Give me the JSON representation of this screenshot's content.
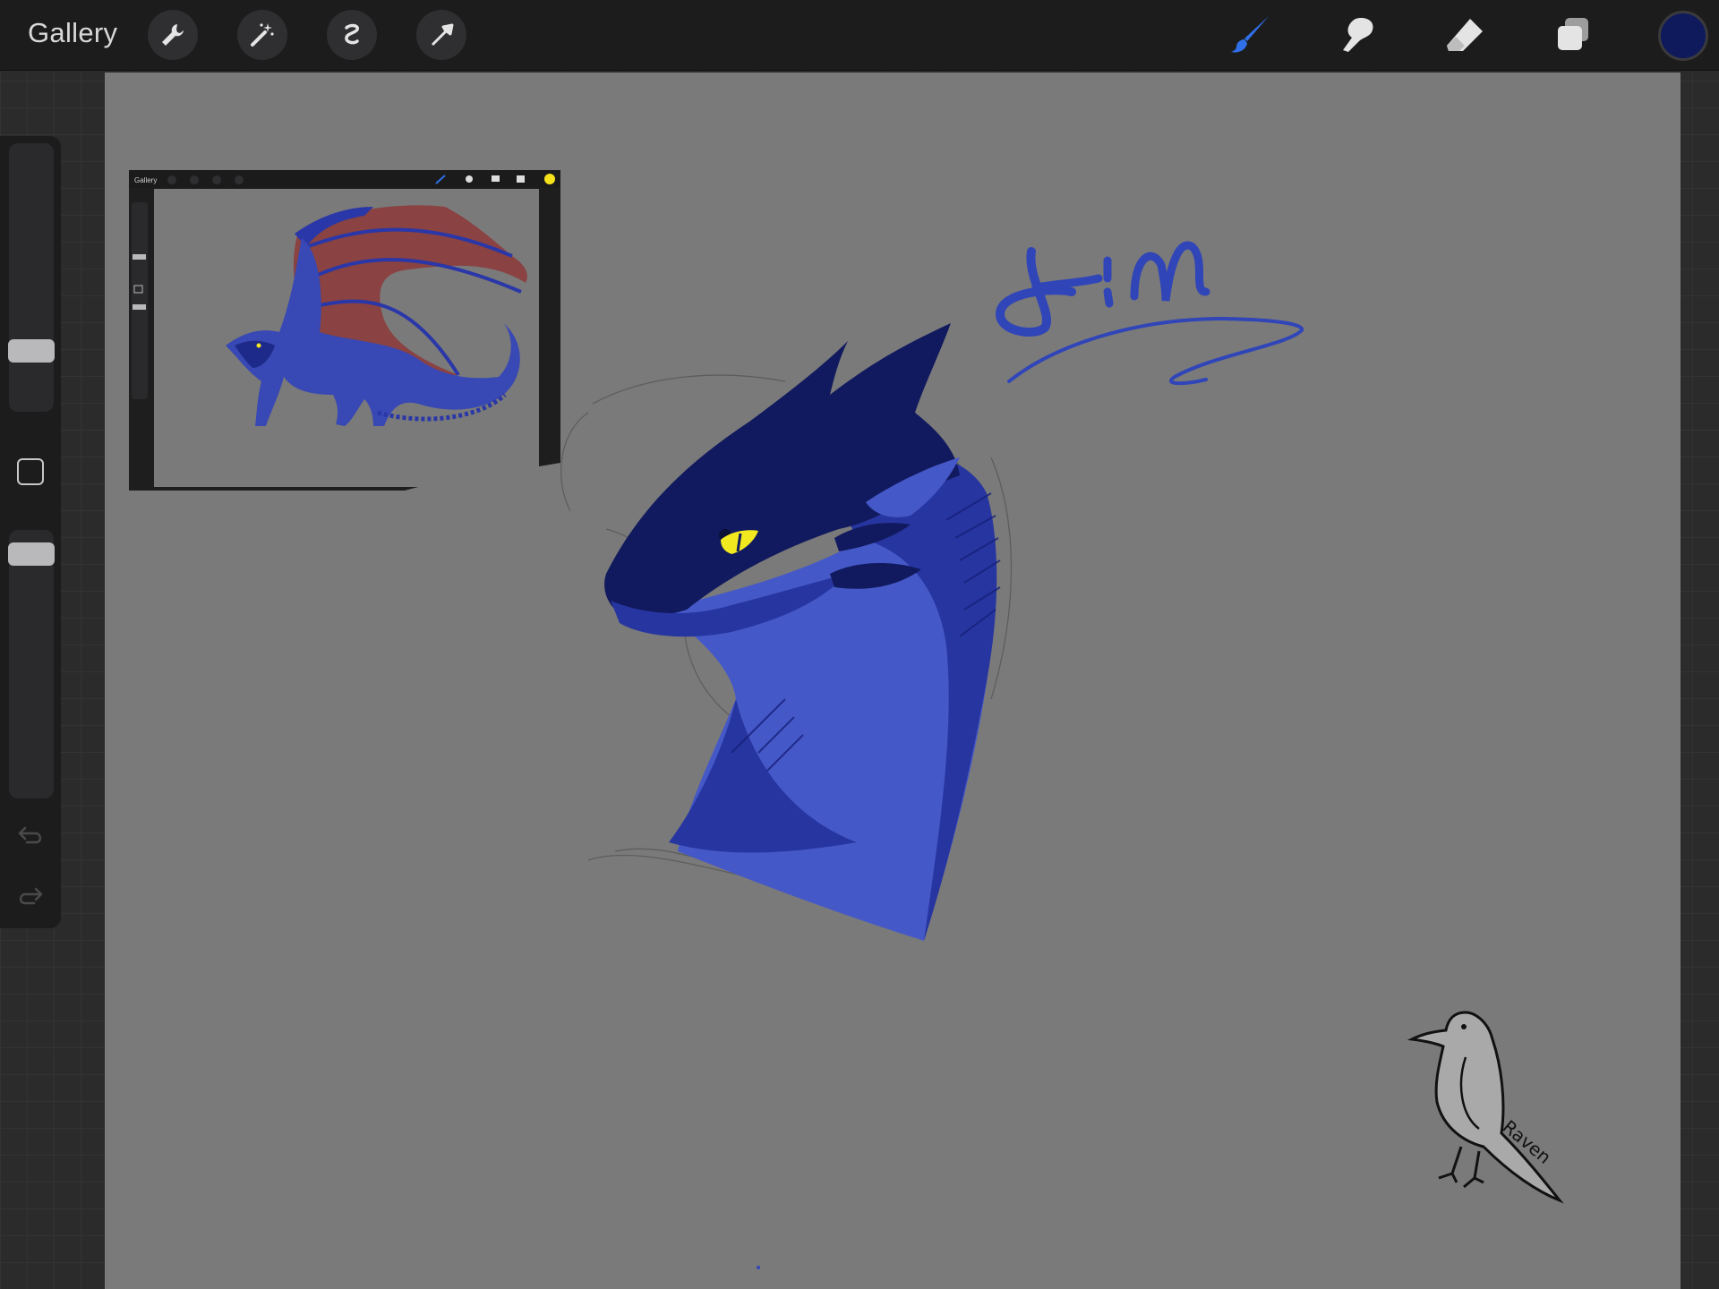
{
  "app": {
    "gallery_label": "Gallery",
    "accent_color": "#2f6fe8",
    "current_color": "#0f1a5c",
    "canvas_color": "#7a7a7a"
  },
  "toolbar": {
    "left_tools": [
      "wrench-icon",
      "magic-wand-icon",
      "selection-icon",
      "transform-arrow-icon"
    ],
    "right_tools": [
      "brush-icon",
      "smudge-icon",
      "eraser-icon",
      "layers-icon"
    ],
    "active_tool": "brush-icon"
  },
  "sidebar": {
    "brush_size_level": 0.2,
    "opacity_level": 0.95,
    "modify_icon": "square-modify-icon",
    "undo_icon": "undo-icon",
    "redo_icon": "redo-icon"
  },
  "reference_inset": {
    "gallery_label": "Gallery",
    "current_color": "#f5e21a",
    "wing_color": "#8a4242",
    "body_color": "#3848b4"
  },
  "artwork": {
    "head_dark": "#111a5e",
    "head_mid": "#2735a0",
    "head_light": "#4558c8",
    "eye_color": "#f2e820",
    "initials_color": "#3045b8",
    "signature_text": "Raven"
  }
}
